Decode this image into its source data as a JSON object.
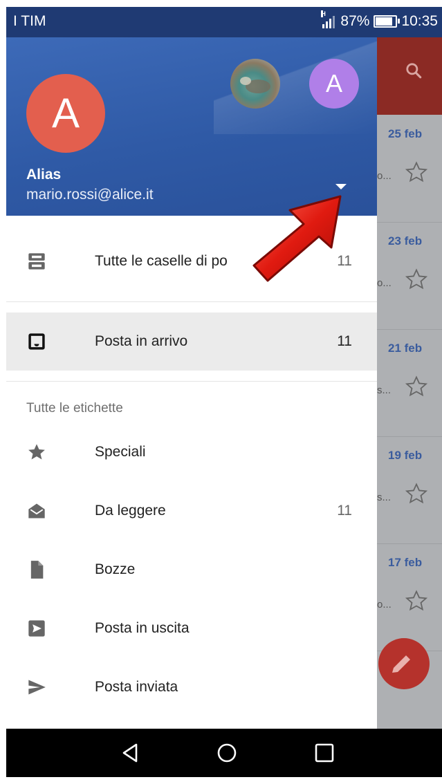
{
  "status_bar": {
    "carrier": "I TIM",
    "battery": "87%",
    "time": "10:35"
  },
  "drawer": {
    "account": {
      "avatar_letter": "A",
      "secondary_avatar_letter": "A",
      "name": "Alias",
      "email": "mario.rossi@alice.it"
    },
    "top_items": [
      {
        "label": "Tutte le caselle di po",
        "count": "11",
        "icon": "all-inboxes-icon"
      },
      {
        "label": "Posta in arrivo",
        "count": "11",
        "icon": "inbox-icon"
      }
    ],
    "section_title": "Tutte le etichette",
    "labels": [
      {
        "label": "Speciali",
        "count": "",
        "icon": "star-icon"
      },
      {
        "label": "Da leggere",
        "count": "11",
        "icon": "open-mail-icon"
      },
      {
        "label": "Bozze",
        "count": "",
        "icon": "draft-icon"
      },
      {
        "label": "Posta in uscita",
        "count": "",
        "icon": "outbox-icon"
      },
      {
        "label": "Posta inviata",
        "count": "",
        "icon": "send-icon"
      }
    ]
  },
  "background_list": {
    "dates": [
      "25 feb",
      "23 feb",
      "21 feb",
      "19 feb",
      "17 feb"
    ],
    "snippets": [
      "o...",
      "o...",
      "s...",
      "s...",
      "o..."
    ]
  },
  "colors": {
    "header": "#2f5aa6",
    "avatar_main": "#e35f4e",
    "avatar_secondary": "#b07fe8",
    "toolbar_bg": "#8b2a24"
  }
}
